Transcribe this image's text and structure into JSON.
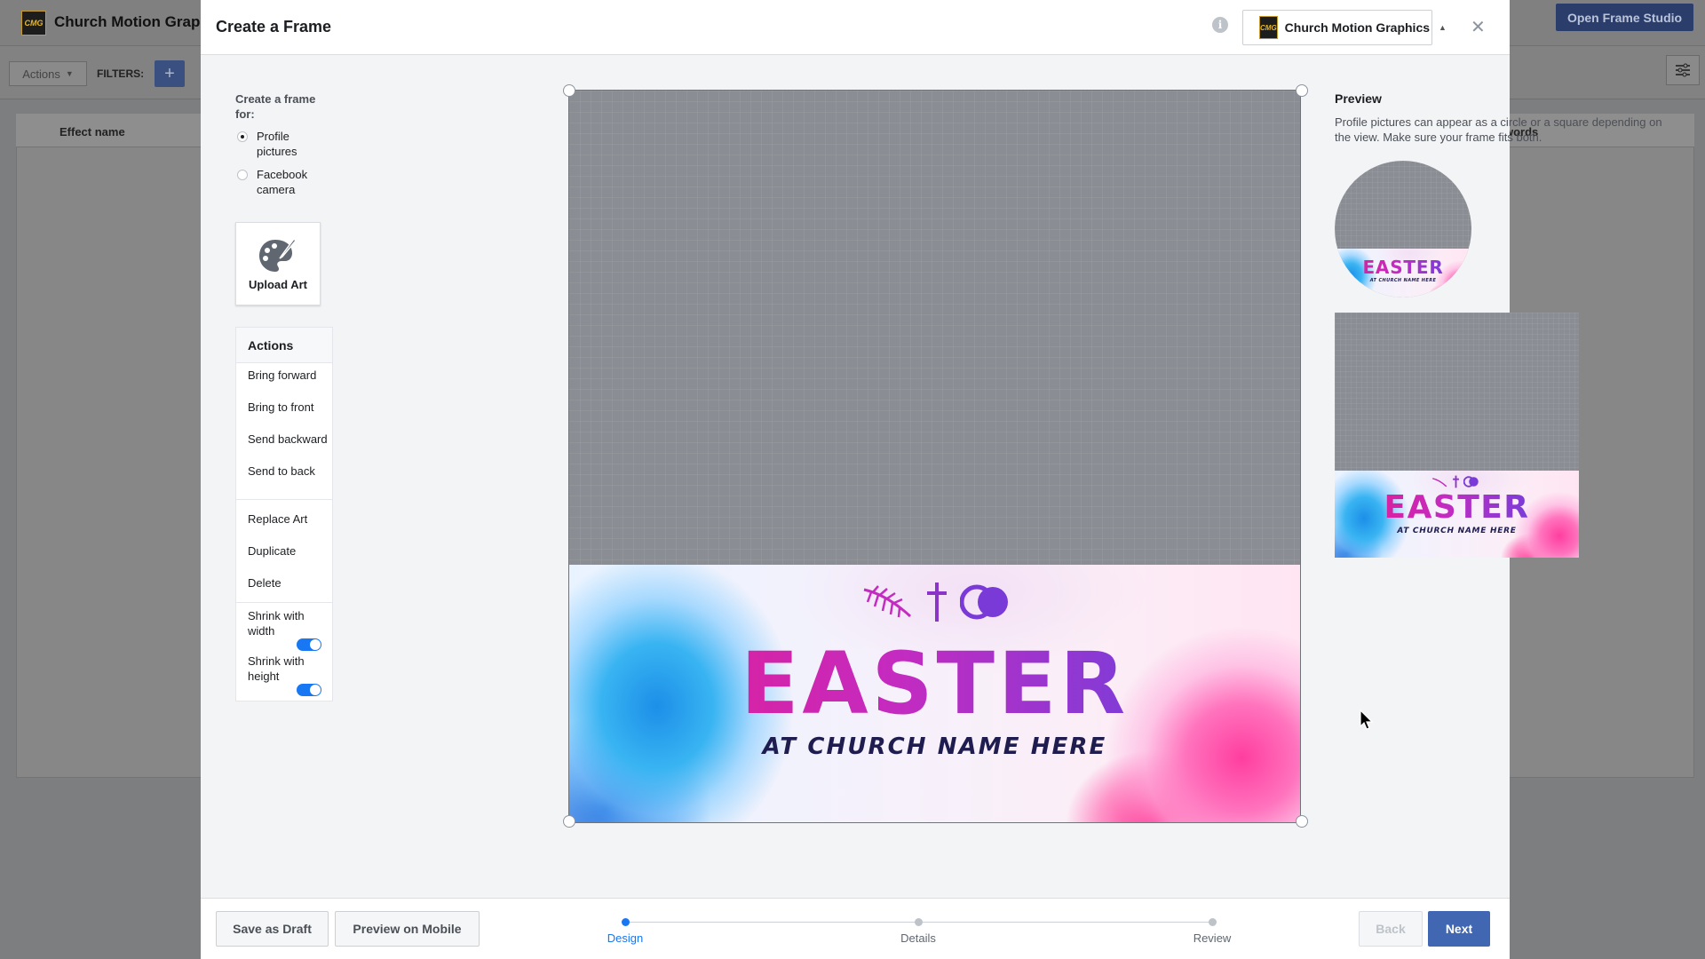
{
  "background_app": {
    "logo_text": "CMG",
    "app_name": "Church Motion Graphics",
    "open_frame_studio": "Open Frame Studio",
    "actions_dropdown": "Actions",
    "filters_label": "FILTERS:",
    "add_filter": "+",
    "table_columns": [
      "Effect name",
      "words"
    ]
  },
  "modal": {
    "title": "Create a Frame",
    "page_selector": {
      "logo_text": "CMG",
      "name": "Church Motion Graphics"
    },
    "frame_for": {
      "label": "Create a frame for:",
      "options": [
        {
          "label": "Profile pictures",
          "checked": true
        },
        {
          "label": "Facebook camera",
          "checked": false
        }
      ]
    },
    "upload_art_label": "Upload Art",
    "actions": {
      "title": "Actions",
      "bring_forward": "Bring forward",
      "bring_to_front": "Bring to front",
      "send_backward": "Send backward",
      "send_to_back": "Send to back",
      "replace_art": "Replace Art",
      "duplicate": "Duplicate",
      "delete": "Delete",
      "shrink_with_width": "Shrink with width",
      "shrink_with_width_on": true,
      "shrink_with_height": "Shrink with height",
      "shrink_with_height_on": true
    },
    "artwork": {
      "headline": "EASTER",
      "subline": "AT CHURCH NAME HERE"
    },
    "preview": {
      "title": "Preview",
      "description": "Profile pictures can appear as a circle or a square depending on the view. Make sure your frame fits both."
    },
    "footer": {
      "save_draft": "Save as Draft",
      "preview_mobile": "Preview on Mobile",
      "steps": [
        {
          "label": "Design",
          "active": true
        },
        {
          "label": "Details",
          "active": false
        },
        {
          "label": "Review",
          "active": false
        }
      ],
      "back": "Back",
      "next": "Next"
    }
  },
  "colors": {
    "primary": "#4267b2",
    "active_step": "#1877f2",
    "easter_gradient_start": "#e81a8a",
    "easter_gradient_end": "#4f47e8",
    "subline": "#1f1d4f"
  }
}
